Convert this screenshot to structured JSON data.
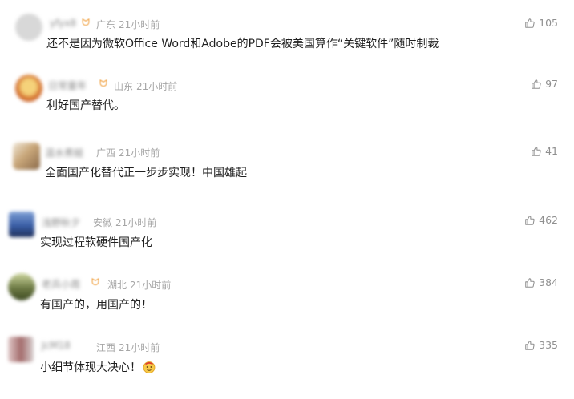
{
  "comments": [
    {
      "username": "yfyx8",
      "badge": true,
      "location": "广东",
      "time": "21小时前",
      "text": "还不是因为微软Office Word和Adobe的PDF会被美国算作“关键软件”随时制裁",
      "likes": "105",
      "avatar_color": "#d7d7d7"
    },
    {
      "username": "日常童年",
      "badge": true,
      "location": "山东",
      "time": "21小时前",
      "text": "利好国产替代。",
      "likes": "97",
      "avatar_color": "#d98a3a"
    },
    {
      "username": "温水煮蛙",
      "badge": false,
      "location": "广西",
      "time": "21小时前",
      "text": "全面国产化替代正一步步实现！中国雄起",
      "likes": "41",
      "avatar_color": "#c9a77a"
    },
    {
      "username": "浅野秋夕",
      "badge": false,
      "location": "安徽",
      "time": "21小时前",
      "text": "实现过程软硬件国产化",
      "likes": "462",
      "avatar_color": "#3a5ea6"
    },
    {
      "username": "老兵小周",
      "badge": true,
      "location": "湖北",
      "time": "21小时前",
      "text": "有国产的，用国产的！",
      "likes": "384",
      "avatar_color": "#6d7a44"
    },
    {
      "username": "JcM18",
      "badge": false,
      "location": "江西",
      "time": "21小时前",
      "text": "小细节体现大决心！",
      "likes": "335",
      "avatar_color": "#a36b6b"
    }
  ]
}
